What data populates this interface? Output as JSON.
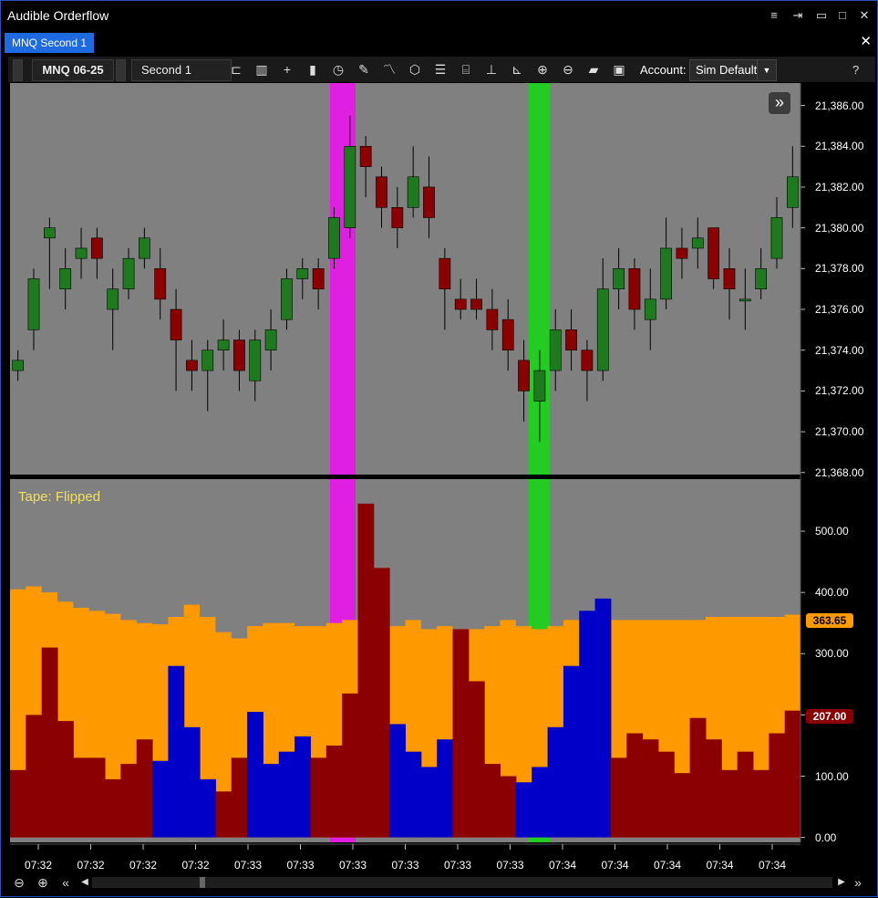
{
  "window": {
    "title": "Audible Orderflow",
    "buttons": [
      "≡",
      "⇥",
      "▭",
      "□",
      "✕"
    ]
  },
  "tab": {
    "label": "MNQ Second 1"
  },
  "toolbar": {
    "instrument": "MNQ 06-25",
    "interval": "Second 1",
    "account_label": "Account:",
    "account_value": "Sim Default",
    "help": "?",
    "icons": [
      "bar-type-icon",
      "volumetric-icon",
      "crosshair-icon",
      "bar-chart-icon",
      "clock-icon",
      "pencil-icon",
      "drawing-icon",
      "cube-icon",
      "list-icon",
      "data-box-icon",
      "axis-icon",
      "axis-alt-icon",
      "zoom-in-icon",
      "zoom-out-icon",
      "folder-icon",
      "save-icon"
    ]
  },
  "price_panel": {
    "price_labels": [
      "21,386.00",
      "21,384.00",
      "21,382.00",
      "21,380.00",
      "21,378.00",
      "21,376.00",
      "21,374.00",
      "21,372.00",
      "21,370.00",
      "21,368.00"
    ],
    "ylim": [
      21367.9,
      21387.1
    ],
    "highlights": [
      {
        "color": "#e020e0",
        "index": 0
      },
      {
        "color": "#22cc22",
        "index": 1
      }
    ],
    "up_color": "#1f7a1f",
    "down_color": "#8b0000"
  },
  "tape_panel": {
    "label": "Tape: Flipped",
    "value_labels": [
      "500.00",
      "400.00",
      "300.00",
      "200.00",
      "100.00",
      "0.00"
    ],
    "ylim": [
      -8,
      585
    ],
    "current_orange": "363.65",
    "current_bar": "207.00",
    "orange_color": "#ff9900",
    "sell_color": "#8b0000",
    "buy_color": "#0000c8"
  },
  "time_labels": [
    "07:32",
    "07:32",
    "07:32",
    "07:32",
    "07:33",
    "07:33",
    "07:33",
    "07:33",
    "07:33",
    "07:33",
    "07:34",
    "07:34",
    "07:34",
    "07:34",
    "07:34"
  ],
  "chart_data": [
    {
      "type": "candlestick",
      "x_labels": [
        "07:32",
        "07:32",
        "07:32",
        "07:32",
        "07:33",
        "07:33",
        "07:33",
        "07:33",
        "07:33",
        "07:33",
        "07:34",
        "07:34",
        "07:34",
        "07:34",
        "07:34"
      ],
      "ylim": [
        21367.9,
        21387.1
      ],
      "closes": [
        21373.5,
        21377.5,
        21380,
        21378,
        21379,
        21378.5,
        21377,
        21378.5,
        21379.5,
        21376.5,
        21374.5,
        21373,
        21374,
        21374.5,
        21373,
        21374.5,
        21375,
        21377.5,
        21378,
        21377,
        21380.5,
        21384,
        21383,
        21381,
        21380,
        21382.5,
        21380.5,
        21377,
        21376,
        21376,
        21375,
        21374,
        21372,
        21373,
        21375,
        21374,
        21373,
        21377,
        21378,
        21376,
        21376.5,
        21379,
        21378.5,
        21379.5,
        21377.5,
        21377,
        21376.5,
        21378,
        21380.5,
        21382.5
      ],
      "opens": [
        21373,
        21375,
        21379.5,
        21377,
        21378.5,
        21379.5,
        21376,
        21377,
        21378.5,
        21378,
        21376,
        21373.5,
        21373,
        21374,
        21374.5,
        21372.5,
        21374,
        21375.5,
        21377.5,
        21378,
        21378.5,
        21380,
        21384,
        21382.5,
        21381,
        21381,
        21382,
        21378.5,
        21376.5,
        21376.5,
        21376,
        21375.5,
        21373.5,
        21371.5,
        21373,
        21375,
        21374,
        21373,
        21377,
        21378,
        21375.5,
        21376.5,
        21379,
        21379,
        21380,
        21378,
        21376.5,
        21377,
        21378.5,
        21381
      ],
      "highs": [
        21374,
        21378,
        21380.5,
        21379,
        21380,
        21380,
        21378,
        21379,
        21380,
        21379,
        21377,
        21374.5,
        21374.5,
        21375.5,
        21375,
        21375,
        21376,
        21378,
        21378.5,
        21378.5,
        21381,
        21385.5,
        21384.5,
        21383,
        21382,
        21384,
        21383.5,
        21379,
        21377.5,
        21377.5,
        21377,
        21376.5,
        21374.5,
        21374,
        21376,
        21376,
        21374.5,
        21378.5,
        21379,
        21378.5,
        21378,
        21380.5,
        21380,
        21380.5,
        21380,
        21379,
        21378,
        21379,
        21381.5,
        21384
      ],
      "lows": [
        21372.5,
        21374,
        21377,
        21376,
        21377.5,
        21377.5,
        21374,
        21376.5,
        21378,
        21375.5,
        21372,
        21372,
        21371,
        21373,
        21372,
        21371.5,
        21373,
        21375,
        21376.5,
        21376,
        21378,
        21379.5,
        21381.5,
        21380,
        21379,
        21380.5,
        21379.5,
        21375,
        21375.5,
        21375.5,
        21374,
        21373,
        21370.5,
        21369.5,
        21372,
        21373,
        21371.5,
        21372.5,
        21376,
        21375,
        21374,
        21376,
        21377.5,
        21378,
        21377,
        21375.5,
        21375,
        21376.5,
        21378,
        21380
      ]
    },
    {
      "type": "bar",
      "series": [
        {
          "name": "Tape: Flipped",
          "values": [
            110,
            200,
            310,
            190,
            130,
            130,
            95,
            120,
            160,
            125,
            280,
            180,
            95,
            75,
            130,
            205,
            120,
            140,
            165,
            130,
            150,
            235,
            545,
            440,
            185,
            140,
            115,
            160,
            340,
            255,
            120,
            100,
            90,
            115,
            180,
            280,
            370,
            390,
            130,
            170,
            160,
            140,
            105,
            195,
            160,
            110,
            140,
            110,
            170,
            207
          ]
        }
      ],
      "overlay_orange": [
        405,
        410,
        400,
        385,
        375,
        370,
        365,
        355,
        350,
        348,
        360,
        380,
        360,
        335,
        325,
        345,
        350,
        350,
        345,
        345,
        350,
        355,
        345,
        345,
        345,
        355,
        340,
        345,
        340,
        340,
        345,
        355,
        345,
        340,
        345,
        355,
        355,
        355,
        355,
        355,
        355,
        355,
        355,
        355,
        360,
        360,
        360,
        360,
        360,
        363.65
      ]
    }
  ]
}
